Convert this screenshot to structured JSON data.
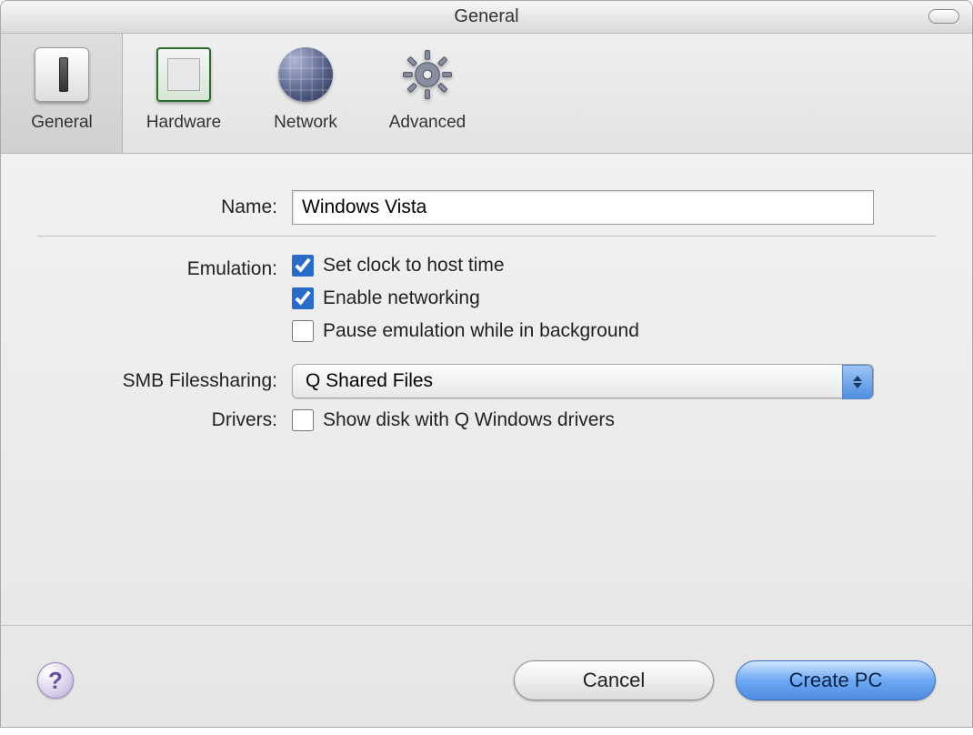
{
  "window": {
    "title": "General"
  },
  "toolbar": {
    "items": [
      {
        "label": "General",
        "active": true
      },
      {
        "label": "Hardware",
        "active": false
      },
      {
        "label": "Network",
        "active": false
      },
      {
        "label": "Advanced",
        "active": false
      }
    ]
  },
  "form": {
    "name_label": "Name:",
    "name_value": "Windows Vista",
    "emulation_label": "Emulation:",
    "clock_label": "Set clock to host time",
    "clock_checked": true,
    "network_label": "Enable networking",
    "network_checked": true,
    "pause_label": "Pause emulation while in background",
    "pause_checked": false,
    "smb_label": "SMB Filessharing:",
    "smb_value": "Q Shared Files",
    "drivers_label": "Drivers:",
    "drivers_check_label": "Show disk with Q Windows drivers",
    "drivers_checked": false
  },
  "footer": {
    "help": "?",
    "cancel": "Cancel",
    "create": "Create PC"
  }
}
